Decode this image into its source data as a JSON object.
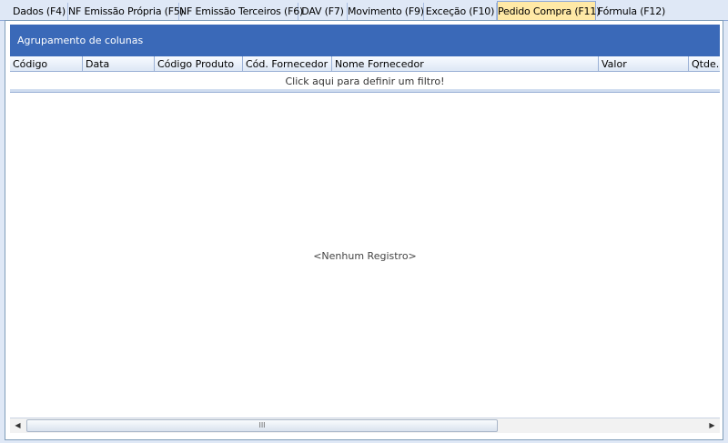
{
  "tabs": [
    {
      "label": "Dados (F4)",
      "active": false
    },
    {
      "label": "NF Emissão Própria (F5)",
      "active": false
    },
    {
      "label": "NF Emissão Terceiros (F6)",
      "active": false
    },
    {
      "label": "DAV (F7)",
      "active": false
    },
    {
      "label": "Movimento (F9)",
      "active": false
    },
    {
      "label": "Exceção (F10)",
      "active": false
    },
    {
      "label": "Pedido Compra (F11)",
      "active": true
    },
    {
      "label": "Fórmula (F12)",
      "active": false
    }
  ],
  "grid": {
    "group_by_text": "Agrupamento de colunas",
    "columns": [
      "Código",
      "Data",
      "Código Produto",
      "Cód. Fornecedor",
      "Nome Fornecedor",
      "Valor",
      "Qtde."
    ],
    "filter_text": "Click aqui para definir um filtro!",
    "empty_text": "<Nenhum Registro>"
  },
  "scrollbar": {
    "left_icon": "arrow-left-icon",
    "right_icon": "arrow-right-icon",
    "grip_text": "III"
  },
  "colors": {
    "groupby_bg": "#3a69b8",
    "active_tab_bg": "#ffe9a6",
    "window_bg": "#dfe8f6"
  }
}
